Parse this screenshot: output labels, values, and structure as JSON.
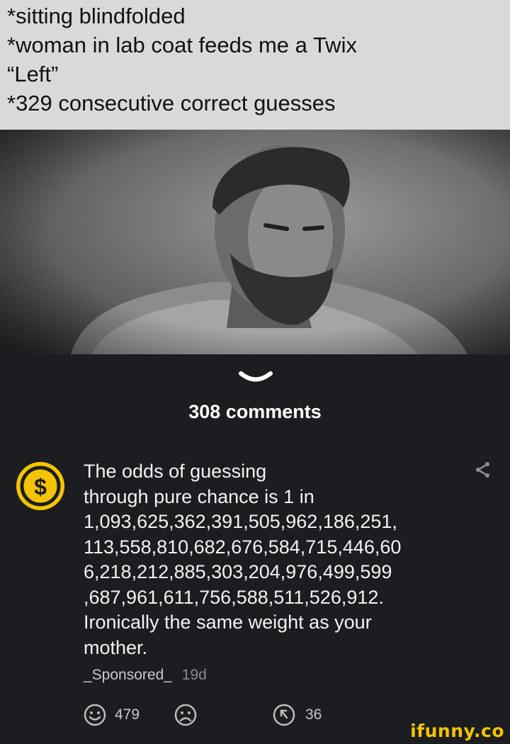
{
  "meme": {
    "caption_lines": [
      "*sitting blindfolded",
      "*woman in lab coat feeds me a Twix",
      "“Left”",
      "*329 consecutive correct guesses"
    ]
  },
  "comments_header": "308 comments",
  "comment": {
    "avatar_icon": "dollar-coin-icon",
    "text_lines": [
      "The odds of guessing",
      "through pure chance is 1 in",
      "1,093,625,362,391,505,962,186,251,",
      "113,558,810,682,676,584,715,446,60",
      "6,218,212,885,303,204,976,499,599",
      ",687,961,611,756,588,511,526,912.",
      "Ironically the same weight as your",
      "mother."
    ],
    "author": "_Sponsored_",
    "time": "19d",
    "smile_count": "479",
    "reply_count": "36"
  },
  "brand": "ifunny.co",
  "colors": {
    "background": "#1c1d21",
    "caption_bg": "#d9d9d9",
    "accent_yellow": "#f5c400"
  }
}
